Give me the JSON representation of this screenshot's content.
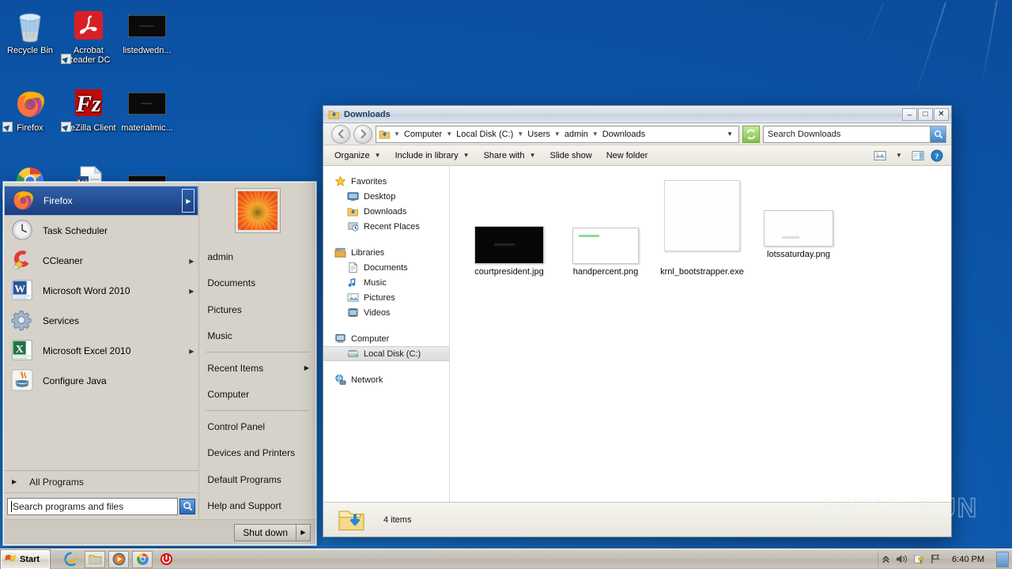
{
  "desktop": {
    "icons": [
      {
        "name": "Recycle Bin",
        "icon": "recycle-bin-icon",
        "shortcut": false
      },
      {
        "name": "Acrobat Reader DC",
        "icon": "acrobat-reader-icon",
        "shortcut": true
      },
      {
        "name": "listedwedn...",
        "icon": "black-thumbnail-icon",
        "shortcut": false
      },
      {
        "name": "Firefox",
        "icon": "firefox-icon",
        "shortcut": true
      },
      {
        "name": "FileZilla Client",
        "icon": "filezilla-icon",
        "shortcut": true
      },
      {
        "name": "materialmic...",
        "icon": "black-thumbnail-icon",
        "shortcut": false
      },
      {
        "name": "",
        "icon": "chrome-icon",
        "shortcut": true
      },
      {
        "name": "",
        "icon": "word-doc-icon",
        "shortcut": false
      },
      {
        "name": "",
        "icon": "black-thumbnail-icon",
        "shortcut": false
      }
    ]
  },
  "start_menu": {
    "programs": [
      {
        "label": "Firefox",
        "icon": "firefox-icon",
        "selected": true,
        "has_submenu": true
      },
      {
        "label": "Task Scheduler",
        "icon": "task-scheduler-icon",
        "selected": false,
        "has_submenu": false
      },
      {
        "label": "CCleaner",
        "icon": "ccleaner-icon",
        "selected": false,
        "has_submenu": true
      },
      {
        "label": "Microsoft Word 2010",
        "icon": "word-icon",
        "selected": false,
        "has_submenu": true
      },
      {
        "label": "Services",
        "icon": "services-icon",
        "selected": false,
        "has_submenu": false
      },
      {
        "label": "Microsoft Excel 2010",
        "icon": "excel-icon",
        "selected": false,
        "has_submenu": true
      },
      {
        "label": "Configure Java",
        "icon": "java-icon",
        "selected": false,
        "has_submenu": false
      }
    ],
    "all_programs_label": "All Programs",
    "search_placeholder": "Search programs and files",
    "search_value": "",
    "user_name": "admin",
    "right_items": [
      {
        "label": "admin",
        "has_submenu": false,
        "separator_after": false
      },
      {
        "label": "Documents",
        "has_submenu": false,
        "separator_after": false
      },
      {
        "label": "Pictures",
        "has_submenu": false,
        "separator_after": false
      },
      {
        "label": "Music",
        "has_submenu": false,
        "separator_after": true
      },
      {
        "label": "Recent Items",
        "has_submenu": true,
        "separator_after": false
      },
      {
        "label": "Computer",
        "has_submenu": false,
        "separator_after": true
      },
      {
        "label": "Control Panel",
        "has_submenu": false,
        "separator_after": false
      },
      {
        "label": "Devices and Printers",
        "has_submenu": false,
        "separator_after": false
      },
      {
        "label": "Default Programs",
        "has_submenu": false,
        "separator_after": false
      },
      {
        "label": "Help and Support",
        "has_submenu": false,
        "separator_after": false
      }
    ],
    "shutdown_label": "Shut down"
  },
  "explorer": {
    "title": "Downloads",
    "window_buttons": {
      "minimize": "_",
      "maximize": "□",
      "close": "✕"
    },
    "breadcrumbs": [
      "Computer",
      "Local Disk (C:)",
      "Users",
      "admin",
      "Downloads"
    ],
    "search_placeholder": "Search Downloads",
    "toolbar": [
      {
        "label": "Organize",
        "has_chevron": true
      },
      {
        "label": "Include in library",
        "has_chevron": true
      },
      {
        "label": "Share with",
        "has_chevron": true
      },
      {
        "label": "Slide show",
        "has_chevron": false
      },
      {
        "label": "New folder",
        "has_chevron": false
      }
    ],
    "toolbar_right_icons": [
      "view-layout-icon",
      "chevron-down-icon",
      "preview-pane-icon",
      "help-icon"
    ],
    "nav_pane": [
      {
        "label": "Favorites",
        "icon": "star-icon",
        "level": 0,
        "selected": false
      },
      {
        "label": "Desktop",
        "icon": "desktop-icon",
        "level": 1,
        "selected": false
      },
      {
        "label": "Downloads",
        "icon": "downloads-folder-icon",
        "level": 1,
        "selected": false
      },
      {
        "label": "Recent Places",
        "icon": "recent-places-icon",
        "level": 1,
        "selected": false
      },
      {
        "label": "",
        "icon": "gap",
        "level": 0,
        "selected": false
      },
      {
        "label": "Libraries",
        "icon": "libraries-icon",
        "level": 0,
        "selected": false
      },
      {
        "label": "Documents",
        "icon": "documents-icon",
        "level": 1,
        "selected": false
      },
      {
        "label": "Music",
        "icon": "music-icon",
        "level": 1,
        "selected": false
      },
      {
        "label": "Pictures",
        "icon": "pictures-icon",
        "level": 1,
        "selected": false
      },
      {
        "label": "Videos",
        "icon": "videos-icon",
        "level": 1,
        "selected": false
      },
      {
        "label": "",
        "icon": "gap",
        "level": 0,
        "selected": false
      },
      {
        "label": "Computer",
        "icon": "computer-icon",
        "level": 0,
        "selected": false
      },
      {
        "label": "Local Disk (C:)",
        "icon": "hard-disk-icon",
        "level": 1,
        "selected": true
      },
      {
        "label": "",
        "icon": "gap",
        "level": 0,
        "selected": false
      },
      {
        "label": "Network",
        "icon": "network-icon",
        "level": 0,
        "selected": false
      }
    ],
    "files": [
      {
        "name": "courtpresident.jpg",
        "thumb": "black-image",
        "w": 86,
        "h": 48
      },
      {
        "name": "handpercent.png",
        "thumb": "white-green-image",
        "w": 82,
        "h": 46
      },
      {
        "name": "krnl_bootstrapper.exe",
        "thumb": "white-tall-image",
        "w": 96,
        "h": 88
      },
      {
        "name": "lotssaturday.png",
        "thumb": "white-gray-image",
        "w": 86,
        "h": 46
      }
    ],
    "status_text": "4 items",
    "status_icon": "downloads-folder-icon"
  },
  "watermark": {
    "text_left": "ANY",
    "text_right": "RUN"
  },
  "taskbar": {
    "start_label": "Start",
    "quick_launch": [
      {
        "name": "internet-explorer-icon",
        "framed": false
      },
      {
        "name": "windows-explorer-icon",
        "framed": true
      },
      {
        "name": "media-player-icon",
        "framed": true
      },
      {
        "name": "chrome-icon",
        "framed": true
      },
      {
        "name": "shutdown-red-icon",
        "framed": false
      }
    ],
    "tray_icons": [
      "show-hidden-icons-icon",
      "volume-icon",
      "action-center-icon",
      "network-flag-icon"
    ],
    "clock": "6:40 PM",
    "show_desktop": "show-desktop-button"
  }
}
